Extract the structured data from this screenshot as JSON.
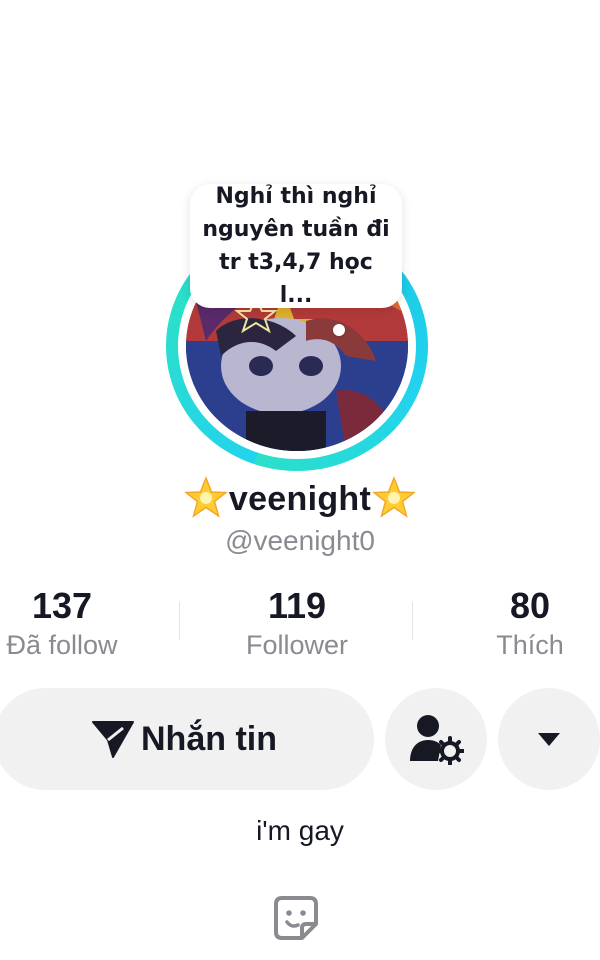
{
  "profile": {
    "note": "Nghỉ thì nghỉ nguyên tuần đi tr t3,4,7 học l...",
    "display_name": "veenight",
    "name_emoji": "star-emoji",
    "username": "@veenight0",
    "bio": "i'm gay"
  },
  "stats": [
    {
      "value": "137",
      "label": "Đã follow"
    },
    {
      "value": "119",
      "label": "Follower"
    },
    {
      "value": "80",
      "label": "Thích"
    }
  ],
  "actions": {
    "message_label": "Nhắn tin",
    "message_icon": "send-icon",
    "friend_icon": "user-settings-icon",
    "more_icon": "caret-down-icon"
  },
  "colors": {
    "ring": "#22d3ee",
    "button_bg": "#f1f1f2",
    "secondary_text": "#8a8b91",
    "star": "#ffcc33"
  }
}
